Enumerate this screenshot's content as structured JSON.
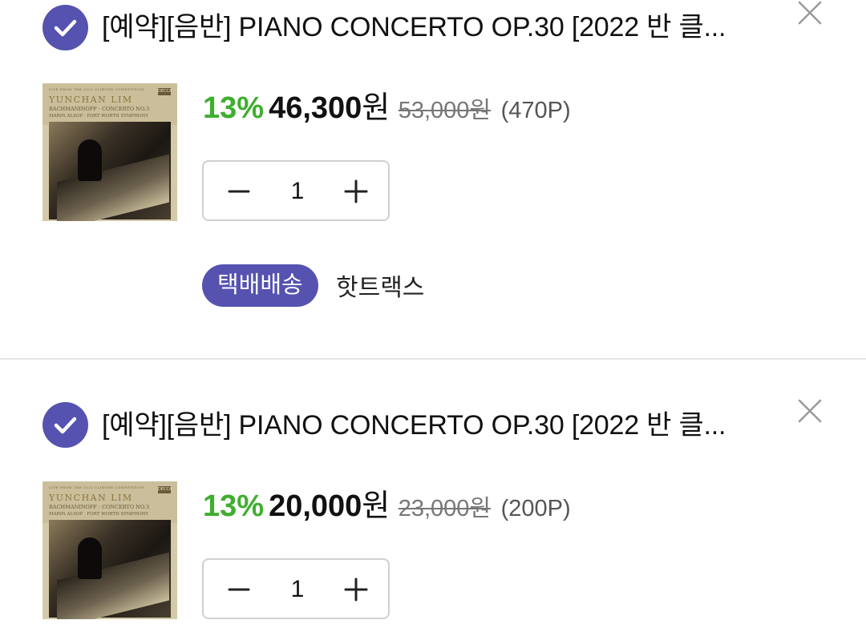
{
  "cart": {
    "items": [
      {
        "checked": true,
        "title": "[예약][음반] PIANO CONCERTO OP.30 [2022 반 클...",
        "cover": {
          "line0": "LIVE FROM THE 2022 CLIBURN COMPETITION",
          "artist": "YUNCHAN LIM",
          "work": "RACHMANINOFF · CONCERTO NO.3",
          "performers": "MARIN ALSOP · FORT WORTH SYMPHONY",
          "label": "DECCA"
        },
        "discount": "13%",
        "price": "46,300",
        "currency": "원",
        "original_price": "53,000원",
        "points": "(470P)",
        "quantity": "1",
        "delivery_badge": "택배배송",
        "courier": "핫트랙스"
      },
      {
        "checked": true,
        "title": "[예약][음반] PIANO CONCERTO OP.30 [2022 반 클...",
        "cover": {
          "line0": "LIVE FROM THE 2022 CLIBURN COMPETITION",
          "artist": "YUNCHAN LIM",
          "work": "RACHMANINOFF · CONCERTO NO.3",
          "performers": "MARIN ALSOP · FORT WORTH SYMPHONY",
          "label": "DECCA"
        },
        "discount": "13%",
        "price": "20,000",
        "currency": "원",
        "original_price": "23,000원",
        "points": "(200P)",
        "quantity": "1"
      }
    ]
  },
  "colors": {
    "accent": "#5552b0",
    "discount": "#3fae2f",
    "muted": "#777777",
    "divider": "#e6e6e6"
  },
  "icons": {
    "check": "check-circle-icon",
    "close": "close-icon",
    "minus": "minus-icon",
    "plus": "plus-icon"
  }
}
